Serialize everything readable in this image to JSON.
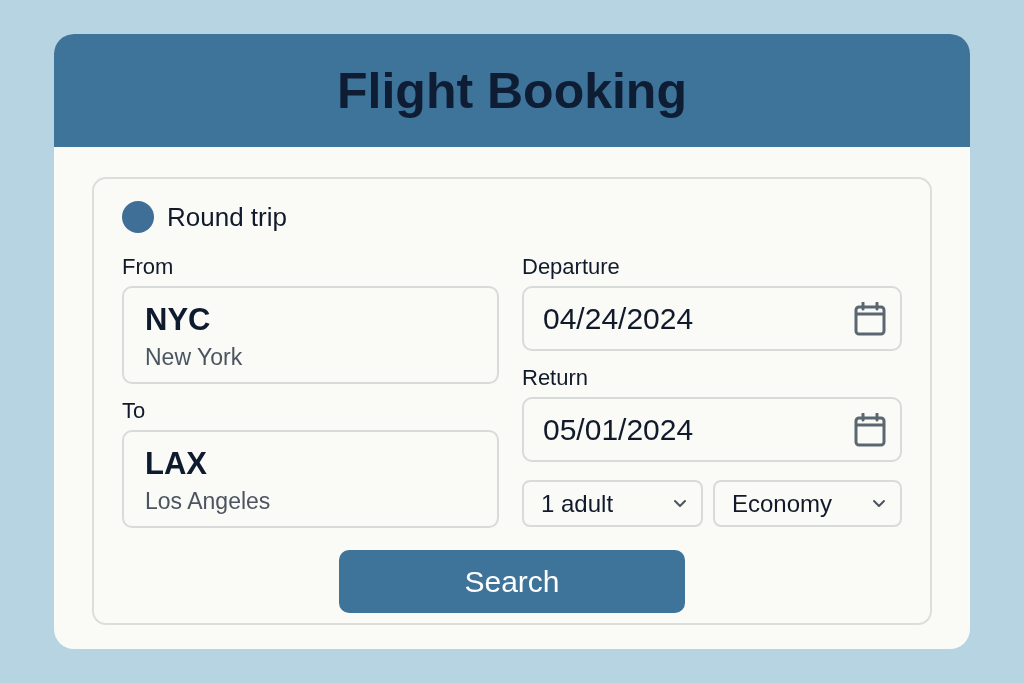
{
  "header": {
    "title": "Flight Booking"
  },
  "trip_type": {
    "label": "Round trip",
    "selected": true
  },
  "locations": [
    {
      "label": "From",
      "code": "NYC",
      "city": "New York"
    },
    {
      "label": "To",
      "code": "LAX",
      "city": "Los Angeles"
    }
  ],
  "dates": [
    {
      "label": "Departure",
      "value": "04/24/2024"
    },
    {
      "label": "Return",
      "value": "05/01/2024"
    }
  ],
  "selects": [
    {
      "kind": "passengers",
      "value": "1 adult"
    },
    {
      "kind": "cabin",
      "value": "Economy"
    }
  ],
  "search_button": {
    "label": "Search"
  }
}
